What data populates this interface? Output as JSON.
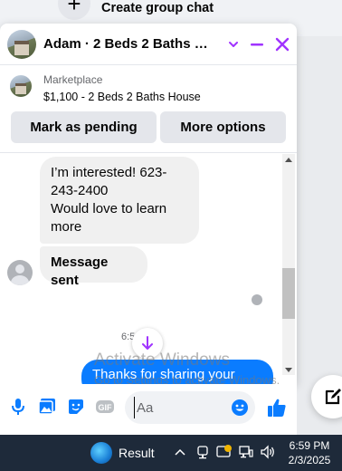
{
  "background": {
    "create_group_label": "Create group chat"
  },
  "chat": {
    "title": "Adam · 2 Beds 2 Baths Ho...",
    "accent_color": "#a033ff",
    "marketplace": {
      "label": "Marketplace",
      "listing": "$1,100 - 2 Beds 2 Baths House"
    },
    "buttons": {
      "mark_pending": "Mark as pending",
      "more_options": "More options"
    },
    "messages": [
      {
        "from": "Adam",
        "text": "I’m interested! 623-243-2400\nWould love to learn more"
      },
      {
        "from": "Adam",
        "text": "Message sent"
      },
      {
        "from": "me",
        "text": "Thanks for sharing your"
      }
    ],
    "timestamp": "6:5",
    "outgoing_color": "#0a7cff"
  },
  "watermark": {
    "line1": "Activate Windows",
    "line2": "Go to Settings to activate Windows."
  },
  "composer": {
    "placeholder": "Aa",
    "icons": [
      "microphone-icon",
      "photo-icon",
      "sticker-icon",
      "gif-icon",
      "emoji-icon",
      "thumbs-up-icon"
    ]
  },
  "taskbar": {
    "app_label": "Result",
    "time": "6:59 PM",
    "date": "2/3/2025"
  }
}
